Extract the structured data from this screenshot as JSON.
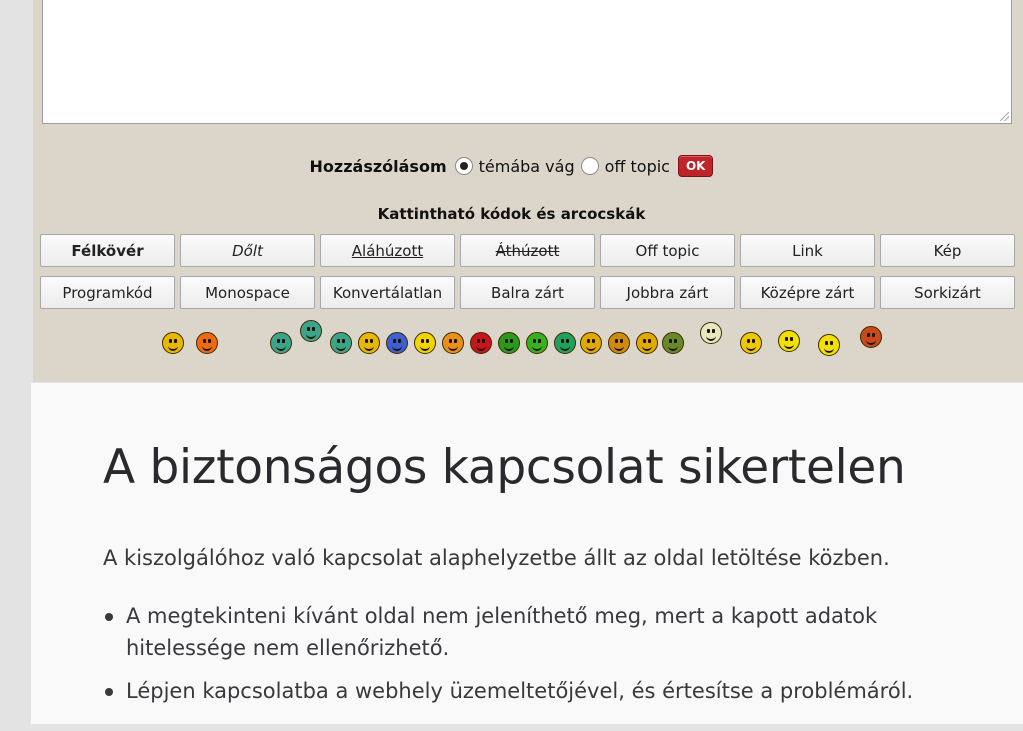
{
  "comment": {
    "label": "Hozzászólásom",
    "options": [
      {
        "label": "témába vág",
        "selected": true
      },
      {
        "label": "off topic",
        "selected": false
      }
    ],
    "ok_label": "OK"
  },
  "codes": {
    "title": "Kattintható kódok és arcocskák",
    "row1": [
      "Félkövér",
      "Dőlt",
      "Aláhúzott",
      "Áthúzott",
      "Off topic",
      "Link",
      "Kép"
    ],
    "row2": [
      "Programkód",
      "Monospace",
      "Konvertálatlan",
      "Balra zárt",
      "Jobbra zárt",
      "Középre zárt",
      "Sorkizárt"
    ]
  },
  "smileys": [
    {
      "name": "smile-icon",
      "color": "#e8b800"
    },
    {
      "name": "sad-orange-icon",
      "color": "#f06a10"
    },
    {
      "name": "grin-green-icon",
      "color": "#3aa58a"
    },
    {
      "name": "grin-green-tall-icon",
      "color": "#3aa58a"
    },
    {
      "name": "teeth-green-icon",
      "color": "#3aa58a"
    },
    {
      "name": "smile-yellow-icon",
      "color": "#e8b800"
    },
    {
      "name": "sad-blue-icon",
      "color": "#3d5fd0"
    },
    {
      "name": "worried-icon",
      "color": "#f2d400"
    },
    {
      "name": "squint-orange-icon",
      "color": "#e8901a"
    },
    {
      "name": "angry-red-icon",
      "color": "#c8141c"
    },
    {
      "name": "shout-green-icon",
      "color": "#2a9a1a"
    },
    {
      "name": "devil-green-icon",
      "color": "#38b020"
    },
    {
      "name": "sick-green-icon",
      "color": "#22a060"
    },
    {
      "name": "smile-gold-icon",
      "color": "#e0aa00"
    },
    {
      "name": "smile-brown-icon",
      "color": "#d08a10"
    },
    {
      "name": "wink-gold-icon",
      "color": "#e0aa00"
    },
    {
      "name": "goggle-eyes-icon",
      "color": "#6a8a2a"
    },
    {
      "name": "alien-icon",
      "color": "#e8e8c0"
    },
    {
      "name": "confused-icon",
      "color": "#f0c800"
    },
    {
      "name": "neutral-icon",
      "color": "#f2e000"
    },
    {
      "name": "sleepy-icon",
      "color": "#f2e000"
    },
    {
      "name": "wall-bang-icon",
      "color": "#c84a1a"
    }
  ],
  "error": {
    "title": "A biztonságos kapcsolat sikertelen",
    "description": "A kiszolgálóhoz való kapcsolat alaphelyzetbe állt az oldal letöltése közben.",
    "bullets": [
      "A megtekinteni kívánt oldal nem jeleníthető meg, mert a kapott adatok hitelessége nem ellenőrizhető.",
      "Lépjen kapcsolatba a webhely üzemeltetőjével, és értesítse a problémáról."
    ]
  }
}
